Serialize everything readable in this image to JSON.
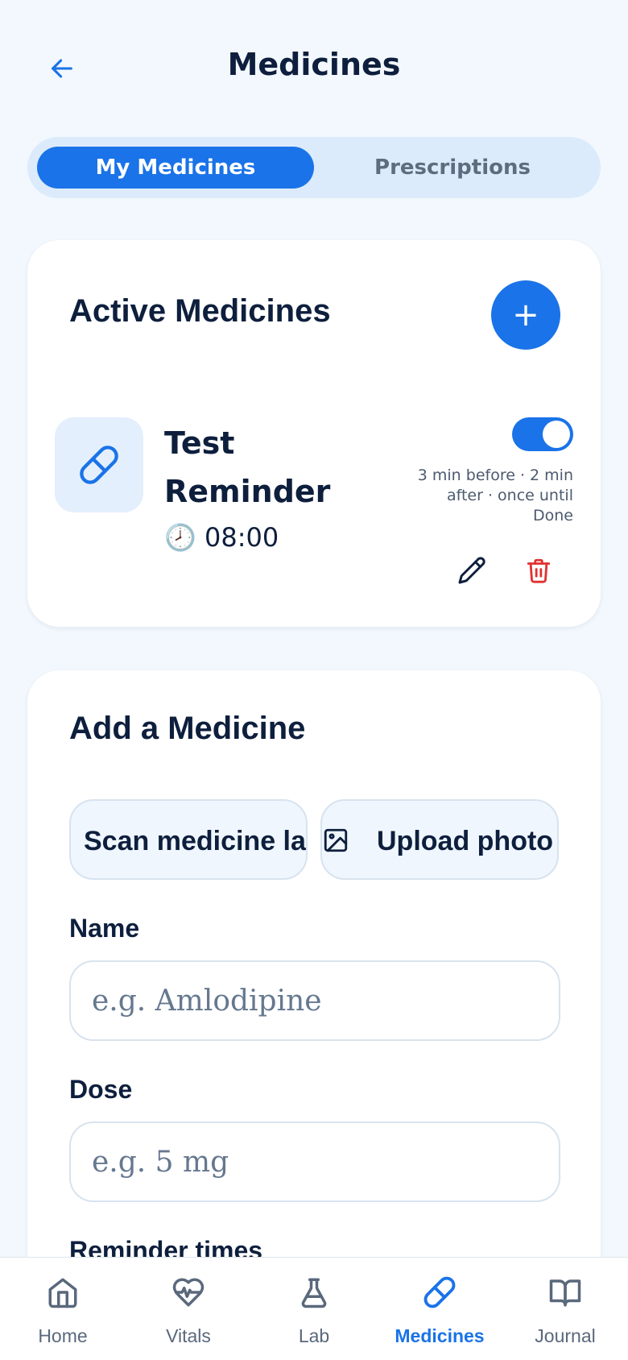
{
  "header": {
    "title": "Medicines"
  },
  "tabs": [
    {
      "label": "My Medicines",
      "active": true
    },
    {
      "label": "Prescriptions",
      "active": false
    }
  ],
  "active_medicines": {
    "title": "Active Medicines",
    "add_button": "+",
    "items": [
      {
        "name": "Test Reminder",
        "time": "🕗 08:00",
        "enabled": true,
        "schedule_note": "3 min before · 2 min after · once until Done"
      }
    ]
  },
  "add_medicine": {
    "title": "Add a Medicine",
    "scan_label": "Scan medicine label",
    "upload_label": "Upload photo",
    "name_label": "Name",
    "name_placeholder": "e.g. Amlodipine",
    "dose_label": "Dose",
    "dose_placeholder": "e.g. 5 mg",
    "reminder_label": "Reminder times"
  },
  "nav": {
    "items": [
      {
        "label": "Home",
        "icon": "home-icon"
      },
      {
        "label": "Vitals",
        "icon": "heart-pulse-icon"
      },
      {
        "label": "Lab",
        "icon": "flask-icon"
      },
      {
        "label": "Medicines",
        "icon": "pill-icon",
        "active": true
      },
      {
        "label": "Journal",
        "icon": "book-icon"
      }
    ]
  },
  "colors": {
    "accent": "#1a73e8",
    "background": "#f2f8fd",
    "danger": "#e03131",
    "text": "#0e1f3d"
  }
}
